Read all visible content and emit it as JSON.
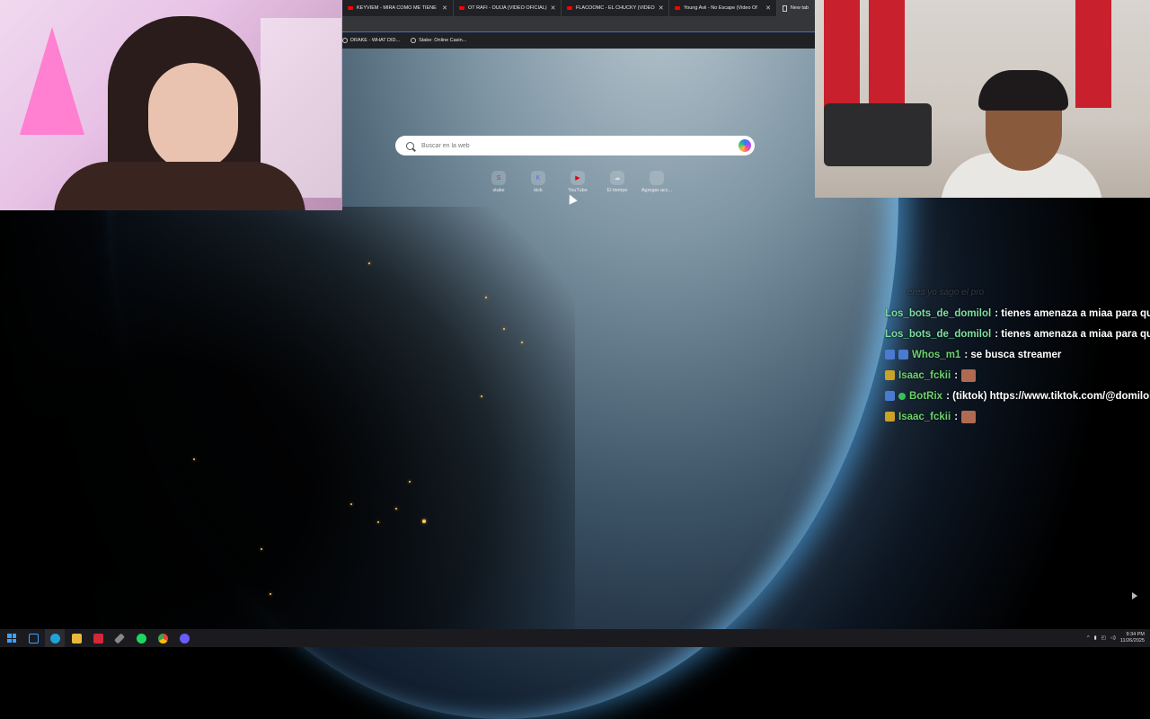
{
  "browser": {
    "tabs": [
      {
        "label": "KEYVIEM - MIRA COMO ME TIENE",
        "icon": "youtube-icon"
      },
      {
        "label": "OT RAFI - OUIJA (VIDEO OFICIAL)",
        "icon": "youtube-icon"
      },
      {
        "label": "FLACOOMC - EL CHUCKY (VIDEO",
        "icon": "youtube-icon"
      },
      {
        "label": "Young Avii - No Escape (Video Of",
        "icon": "youtube-icon"
      },
      {
        "label": "New tab",
        "icon": "newtab-icon"
      }
    ],
    "bookmarks": [
      {
        "label": "DRAKE - WHAT DID..."
      },
      {
        "label": "Stake: Online Casin..."
      }
    ]
  },
  "newtab": {
    "search_placeholder": "Buscar en la web",
    "shortcuts": [
      {
        "label": "stake",
        "glyph": "S",
        "color": "#c0392b"
      },
      {
        "label": "kick",
        "glyph": "K",
        "color": "#5a6bd6"
      },
      {
        "label": "YouTube",
        "glyph": "▶",
        "color": "#e00000"
      },
      {
        "label": "El tiempo",
        "glyph": "☁",
        "color": "#dddddd"
      },
      {
        "label": "Agregar acc...",
        "glyph": "+",
        "color": "#aaaaaa"
      }
    ]
  },
  "chat": {
    "faded_line": "eres yo sago el pro",
    "messages": [
      {
        "user": "Los_bots_de_domilol",
        "text": ": tienes amenaza a miaa para que",
        "badges": [],
        "color": "#7de0a0"
      },
      {
        "user": "Los_bots_de_domilol",
        "text": ": tienes amenaza a miaa para que",
        "badges": [],
        "color": "#7de0a0"
      },
      {
        "user": "Whos_m1",
        "text": ": se busca streamer",
        "badges": [
          "blue",
          "blue"
        ],
        "color": "#6cd36a"
      },
      {
        "user": "Isaac_fckii",
        "text": ":",
        "badges": [
          "gold"
        ],
        "emote": true,
        "color": "#6cd36a"
      },
      {
        "user": "BotRix",
        "text": ": (tiktok) https://www.tiktok.com/@domilol",
        "badges": [
          "blue",
          "green"
        ],
        "color": "#6cd36a"
      },
      {
        "user": "Isaac_fckii",
        "text": ":",
        "badges": [
          "gold"
        ],
        "emote": true,
        "color": "#6cd36a"
      }
    ]
  },
  "taskbar": {
    "apps": [
      {
        "name": "start-button"
      },
      {
        "name": "search-taskbar-button"
      },
      {
        "name": "edge-icon",
        "color": "#1fa3d8"
      },
      {
        "name": "file-explorer-icon",
        "color": "#e8b93a"
      },
      {
        "name": "app-red-icon",
        "color": "#d6263a"
      },
      {
        "name": "app-feather-icon",
        "color": "#aaaaaa"
      },
      {
        "name": "spotify-icon",
        "color": "#1ed760"
      },
      {
        "name": "chrome-icon",
        "color": "#e94235"
      },
      {
        "name": "app-blue-icon",
        "color": "#6a5cff"
      }
    ],
    "time": "9:34 PM",
    "date": "11/26/2025"
  }
}
